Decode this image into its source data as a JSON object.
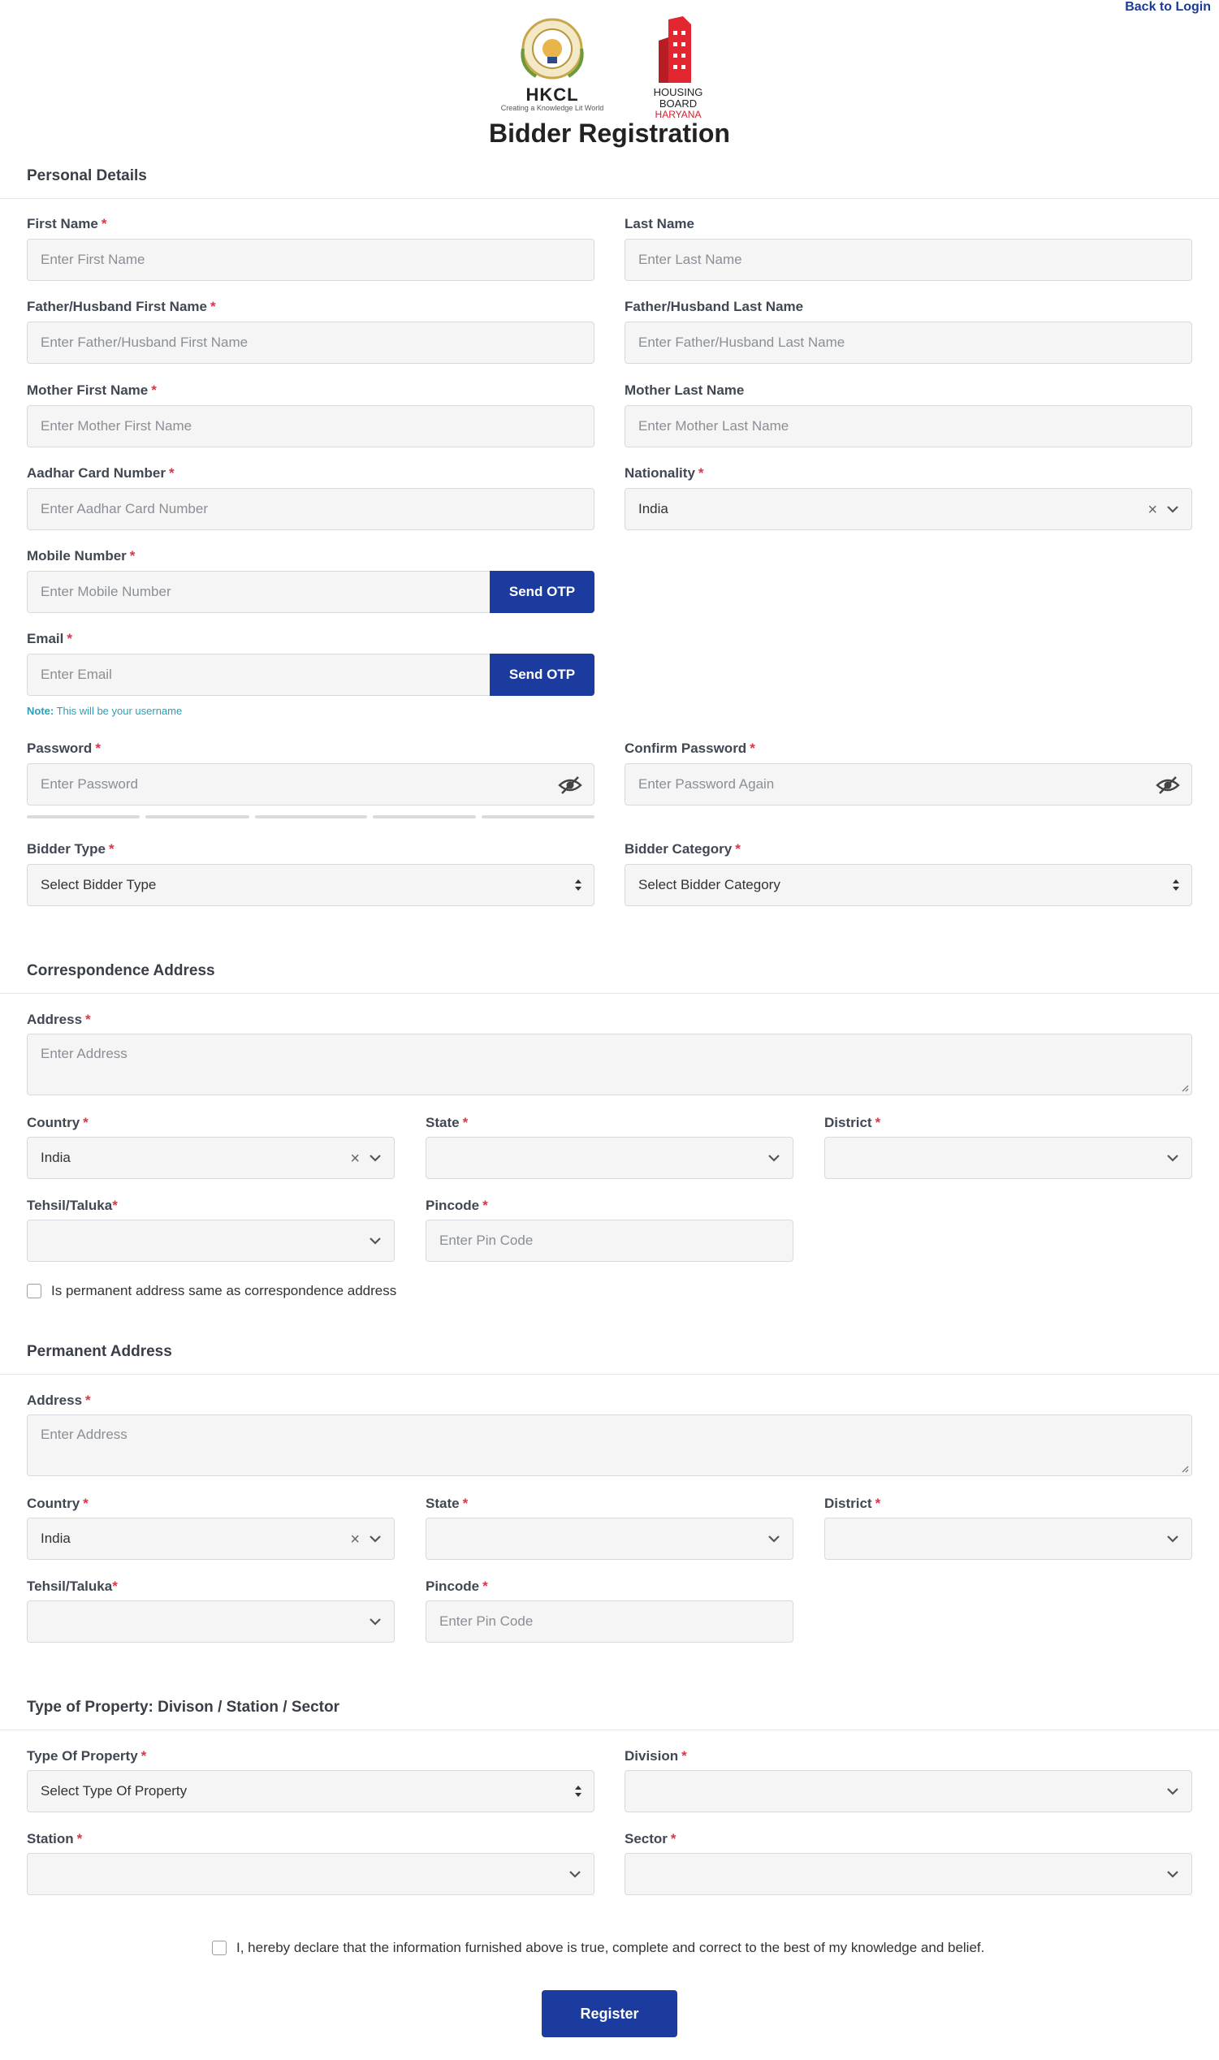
{
  "header": {
    "back_to_login": "Back to Login",
    "logo_hkcl_text": "HKCL",
    "logo_hkcl_tagline": "Creating a Knowledge Lit World",
    "logo_hb_text": "HOUSING BOARD",
    "logo_hb_sub": "HARYANA",
    "page_title": "Bidder Registration"
  },
  "personal": {
    "section_title": "Personal Details",
    "first_name_label": "First Name",
    "first_name_placeholder": "Enter First Name",
    "last_name_label": "Last Name",
    "last_name_placeholder": "Enter Last Name",
    "father_first_label": "Father/Husband First Name",
    "father_first_placeholder": "Enter Father/Husband First Name",
    "father_last_label": "Father/Husband Last Name",
    "father_last_placeholder": "Enter Father/Husband Last Name",
    "mother_first_label": "Mother First Name",
    "mother_first_placeholder": "Enter Mother First Name",
    "mother_last_label": "Mother Last Name",
    "mother_last_placeholder": "Enter Mother Last Name",
    "aadhar_label": "Aadhar Card Number",
    "aadhar_placeholder": "Enter Aadhar Card Number",
    "nationality_label": "Nationality",
    "nationality_value": "India",
    "mobile_label": "Mobile Number",
    "mobile_placeholder": "Enter Mobile Number",
    "send_otp": "Send OTP",
    "email_label": "Email",
    "email_placeholder": "Enter Email",
    "note_prefix": "Note:",
    "note_text": "This will be your username",
    "password_label": "Password",
    "password_placeholder": "Enter Password",
    "confirm_password_label": "Confirm Password",
    "confirm_password_placeholder": "Enter Password Again",
    "bidder_type_label": "Bidder Type",
    "bidder_type_value": "Select Bidder Type",
    "bidder_category_label": "Bidder Category",
    "bidder_category_value": "Select Bidder Category"
  },
  "correspondence": {
    "section_title": "Correspondence Address",
    "address_label": "Address",
    "address_placeholder": "Enter Address",
    "country_label": "Country",
    "country_value": "India",
    "state_label": "State",
    "district_label": "District",
    "tehsil_label": "Tehsil/Taluka",
    "pincode_label": "Pincode",
    "pincode_placeholder": "Enter Pin Code",
    "same_address_label": "Is permanent address same as correspondence address"
  },
  "permanent": {
    "section_title": "Permanent Address",
    "address_label": "Address",
    "address_placeholder": "Enter Address",
    "country_label": "Country",
    "country_value": "India",
    "state_label": "State",
    "district_label": "District",
    "tehsil_label": "Tehsil/Taluka",
    "pincode_label": "Pincode",
    "pincode_placeholder": "Enter Pin Code"
  },
  "property": {
    "section_title": "Type of Property: Divison / Station / Sector",
    "type_label": "Type Of Property",
    "type_value": "Select Type Of Property",
    "division_label": "Division",
    "station_label": "Station",
    "sector_label": "Sector"
  },
  "footer": {
    "declaration": "I, hereby declare that the information furnished above is true, complete and correct to the best of my knowledge and belief.",
    "register": "Register"
  },
  "required_mark": "*",
  "colors": {
    "primary_button": "#1c3b9f",
    "required": "#dc3545",
    "note": "#2aa0b8",
    "field_bg": "#f5f5f5"
  }
}
